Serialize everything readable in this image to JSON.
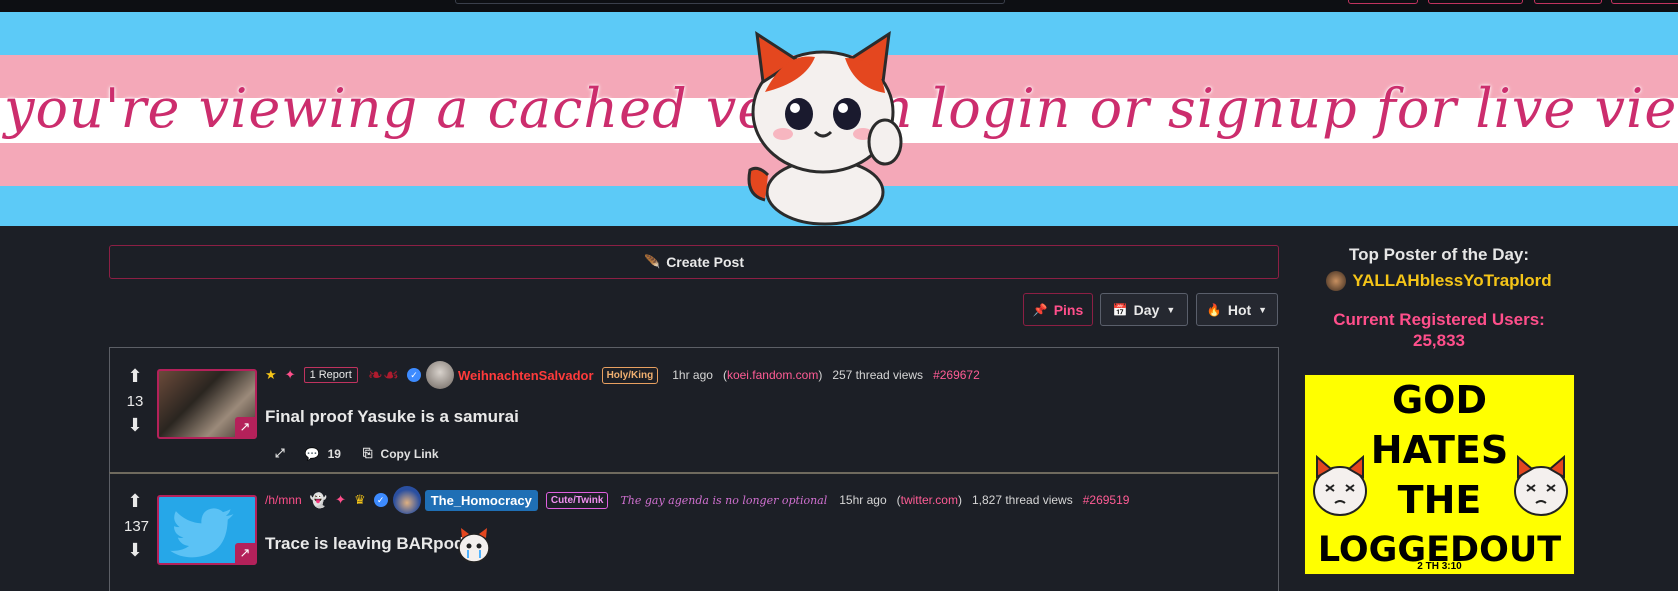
{
  "banner": {
    "left_text": "you're viewing a cached version",
    "right_text": "login or signup for live viewing"
  },
  "main": {
    "create_post_label": "Create Post",
    "filters": {
      "pins_label": "Pins",
      "time_label": "Day",
      "sort_label": "Hot"
    }
  },
  "posts": [
    {
      "score": "13",
      "report_badge": "1 Report",
      "author": "WeihnachtenSalvador",
      "author_color": "#ff3b3b",
      "flair": "Holy/King",
      "time": "1hr ago",
      "domain": "koei.fandom.com",
      "views": "257 thread views",
      "post_id": "#269672",
      "title": "Final proof Yasuke is a samurai",
      "comments": "19",
      "copy_link_label": "Copy Link"
    },
    {
      "score": "137",
      "board": "/h/mnn",
      "author": "The_Homocracy",
      "flair": "Cute/Twink",
      "tagline": "The gay agenda is no longer optional",
      "time": "15hr ago",
      "domain": "twitter.com",
      "views": "1,827 thread views",
      "post_id": "#269519",
      "title": "Trace is leaving BARpod"
    }
  ],
  "sidebar": {
    "top_poster_label": "Top Poster of the Day:",
    "top_poster_name": "YALLAHblessYoTraplord",
    "registered_label": "Current Registered Users:",
    "registered_count": "25,833",
    "ad_lines": [
      "GOD",
      "HATES",
      "THE",
      "LOGGEDOUT"
    ],
    "ad_verse": "2 TH 3:10"
  }
}
